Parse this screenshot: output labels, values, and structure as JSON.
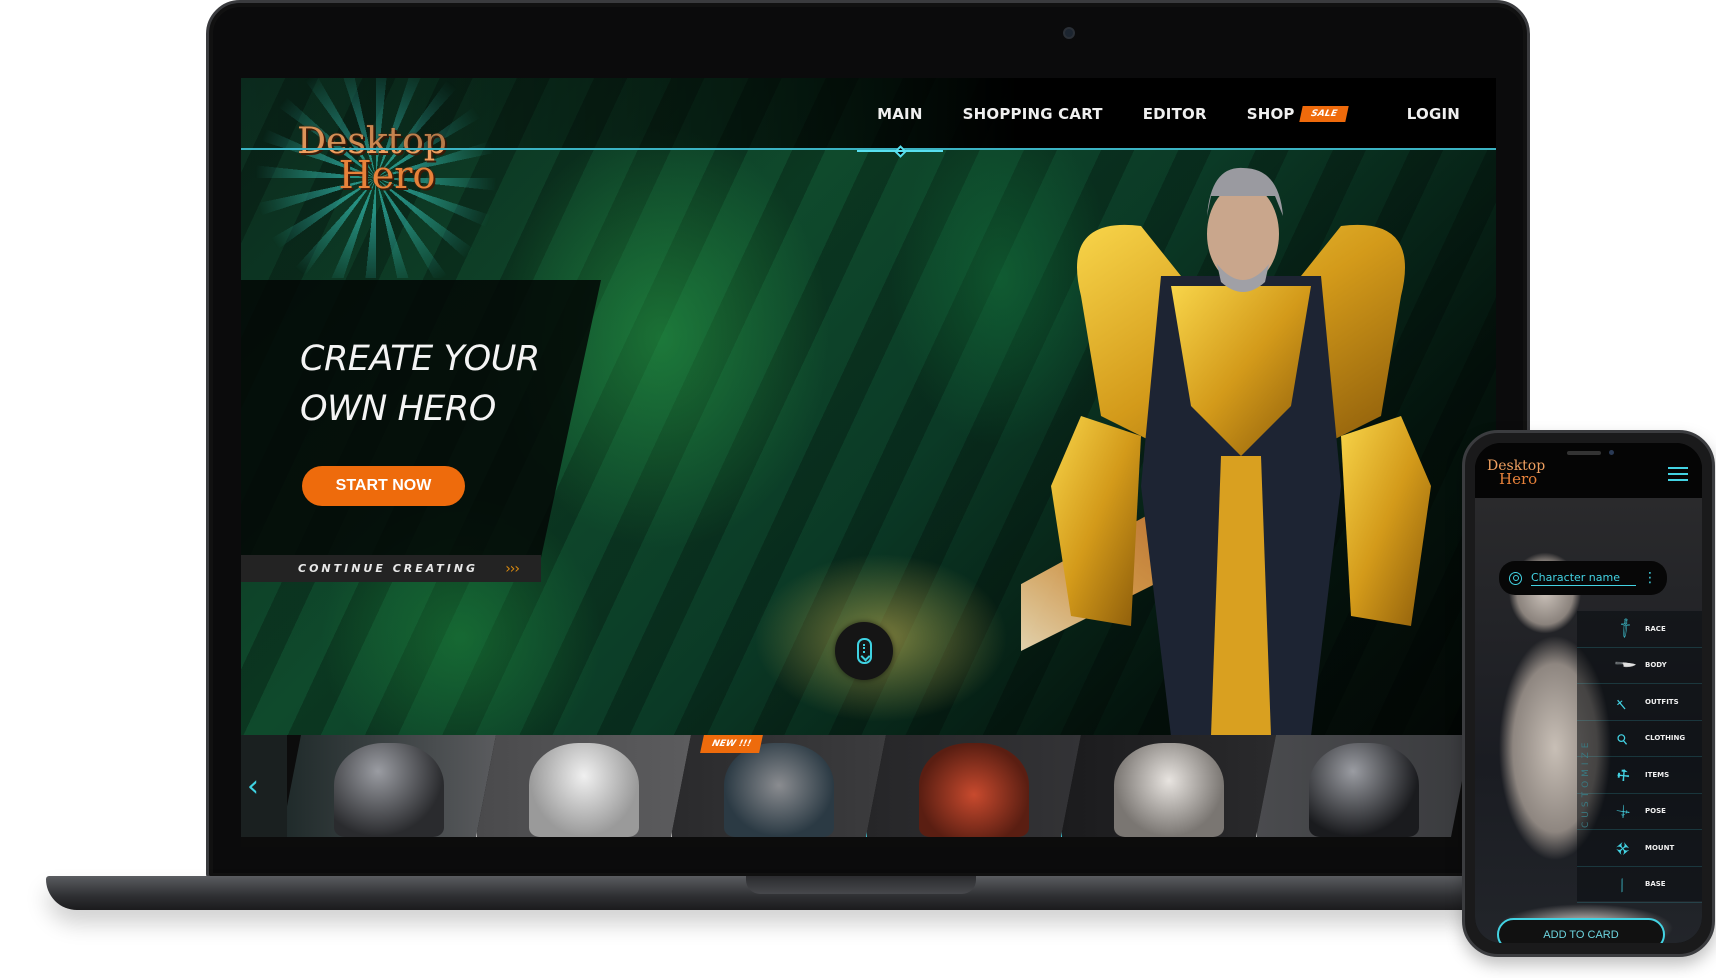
{
  "site": {
    "logo": {
      "line1": "Desktop",
      "line2": "Hero"
    },
    "nav": [
      {
        "label": "MAIN",
        "active": true
      },
      {
        "label": "SHOPPING CART",
        "active": false
      },
      {
        "label": "EDITOR",
        "active": false
      },
      {
        "label": "SHOP",
        "active": false,
        "badge": "SALE"
      },
      {
        "label": "LOGIN",
        "active": false
      }
    ],
    "hero": {
      "title_line1": "CREATE YOUR",
      "title_line2": "OWN HERO",
      "cta": "START NOW",
      "continue": "CONTINUE CREATING",
      "continue_arrows": "›››",
      "scroll_icon": "mouse-scroll-icon"
    },
    "carousel": {
      "prev_icon": "chevron-left-icon",
      "prev_glyph": "‹",
      "tiles": [
        {
          "name": "alien",
          "badge": ""
        },
        {
          "name": "warrior-woman",
          "badge": ""
        },
        {
          "name": "mech-robot",
          "badge": "NEW !!!"
        },
        {
          "name": "red-tank",
          "badge": ""
        },
        {
          "name": "sword-lady",
          "badge": ""
        },
        {
          "name": "alien-2",
          "badge": ""
        }
      ]
    }
  },
  "phone": {
    "logo": {
      "line1": "Desktop",
      "line2": "Hero"
    },
    "menu_icon": "hamburger-icon",
    "character_name_placeholder": "Character name",
    "more_glyph": "⋮",
    "customize_label": "CUSTOMIZE",
    "customize_items": [
      {
        "label": "RACE",
        "icon": "sword-icon"
      },
      {
        "label": "BODY",
        "icon": "knife-icon"
      },
      {
        "label": "OUTFITS",
        "icon": "dagger-icon"
      },
      {
        "label": "CLOTHING",
        "icon": "wand-icon"
      },
      {
        "label": "ITEMS",
        "icon": "hammer-icon"
      },
      {
        "label": "POSE",
        "icon": "axe-icon"
      },
      {
        "label": "MOUNT",
        "icon": "mace-icon"
      },
      {
        "label": "BASE",
        "icon": "spear-icon"
      }
    ],
    "add_button": "ADD TO CARD"
  },
  "colors": {
    "accent": "#43d3e3",
    "orange": "#ee6b0c"
  }
}
